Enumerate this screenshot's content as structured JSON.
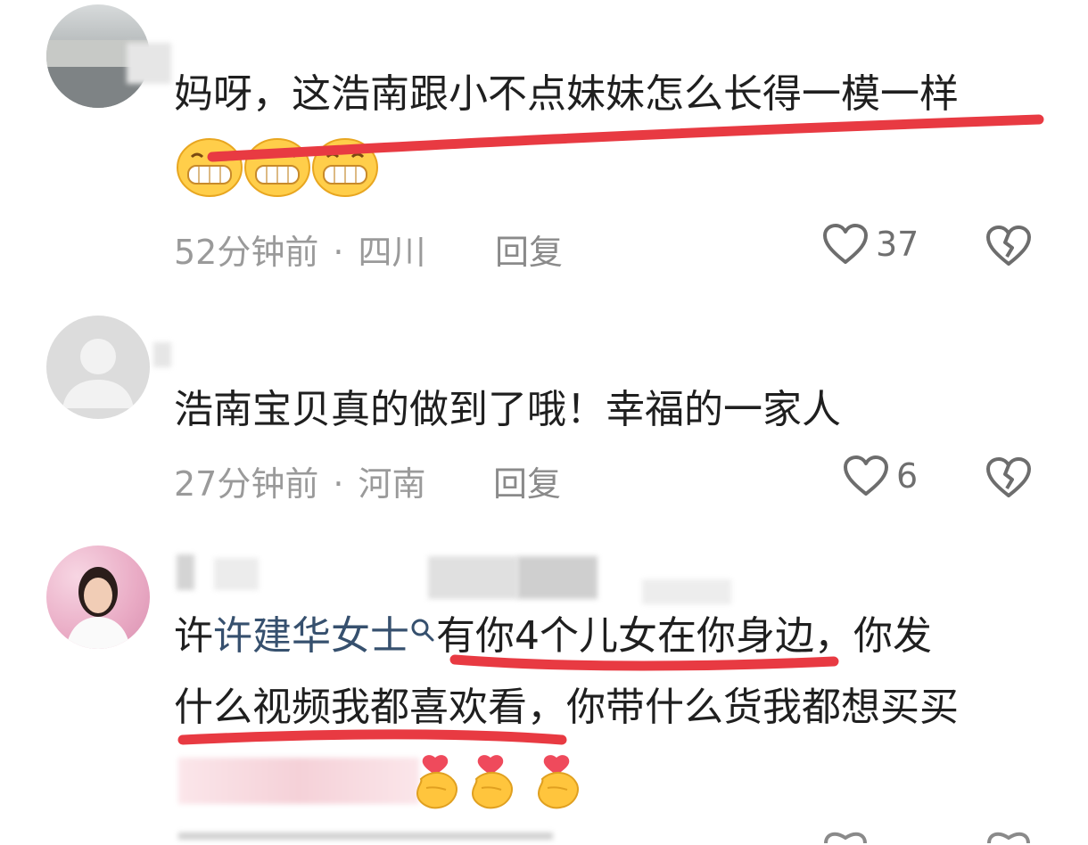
{
  "comments": [
    {
      "text": "妈呀，这浩南跟小不点妹妹怎么长得一模一样",
      "time": "52分钟前",
      "location": "四川",
      "reply_label": "回复",
      "likes": "37",
      "emoji_count": 3
    },
    {
      "text": "浩南宝贝真的做到了哦！幸福的一家人",
      "time": "27分钟前",
      "location": "河南",
      "reply_label": "回复",
      "likes": "6"
    },
    {
      "text_prefix": "许",
      "mention": "许建华女士",
      "line1_rest": "有你4个儿女在你身边，你发",
      "line2": "什么视频我都喜欢看，你带什么货我都想买买"
    }
  ],
  "colors": {
    "highlight_red": "#e83a42",
    "mention_blue": "#36506e",
    "meta_gray": "#9a9a9a"
  }
}
